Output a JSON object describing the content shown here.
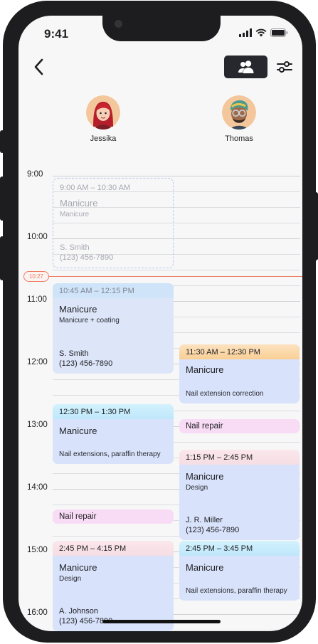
{
  "status_bar": {
    "time": "9:41"
  },
  "staff": [
    {
      "name": "Jessika"
    },
    {
      "name": "Thomas"
    }
  ],
  "hours": [
    "9:00",
    "10:00",
    "11:00",
    "12:00",
    "13:00",
    "14:00",
    "15:00",
    "16:00"
  ],
  "now_badge": "10:27",
  "appointments": {
    "ghost": {
      "range": "9:00 AM – 10:30 AM",
      "title": "Manicure",
      "sub": "Manicure",
      "client_name": "S. Smith",
      "client_phone": "(123) 456-7890"
    },
    "a1": {
      "range": "10:45 AM – 12:15 PM",
      "title": "Manicure",
      "sub": "Manicure + coating",
      "client_name": "S. Smith",
      "client_phone": "(123) 456-7890"
    },
    "a2": {
      "range": "11:30 AM – 12:30 PM",
      "title": "Manicure",
      "sub": "Nail extension correction"
    },
    "a3": {
      "range": "12:30 PM – 1:30 PM",
      "title": "Manicure",
      "sub": "Nail extensions, paraffin therapy"
    },
    "tag1": {
      "title": "Nail repair"
    },
    "a4": {
      "range": "1:15 PM – 2:45 PM",
      "title": "Manicure",
      "sub": "Design",
      "client_name": "J. R. Miller",
      "client_phone": "(123) 456-7890"
    },
    "tag2": {
      "title": "Nail repair"
    },
    "a5": {
      "range": "2:45 PM – 4:15 PM",
      "title": "Manicure",
      "sub": "Design",
      "client_name": "A. Johnson",
      "client_phone": "(123) 456-7890"
    },
    "a6": {
      "range": "2:45 PM – 3:45 PM",
      "title": "Manicure",
      "sub": "Nail extensions, paraffin therapy"
    }
  },
  "colors": {
    "appointment_blue": "#d8e3fb",
    "header_blue": "#c2ecfb",
    "header_orange": "#fcd9ae",
    "header_pink": "#f9dfe6",
    "tag_pink": "#f8dbf4",
    "now_red": "#ef7a5e",
    "dark": "#26282d"
  }
}
